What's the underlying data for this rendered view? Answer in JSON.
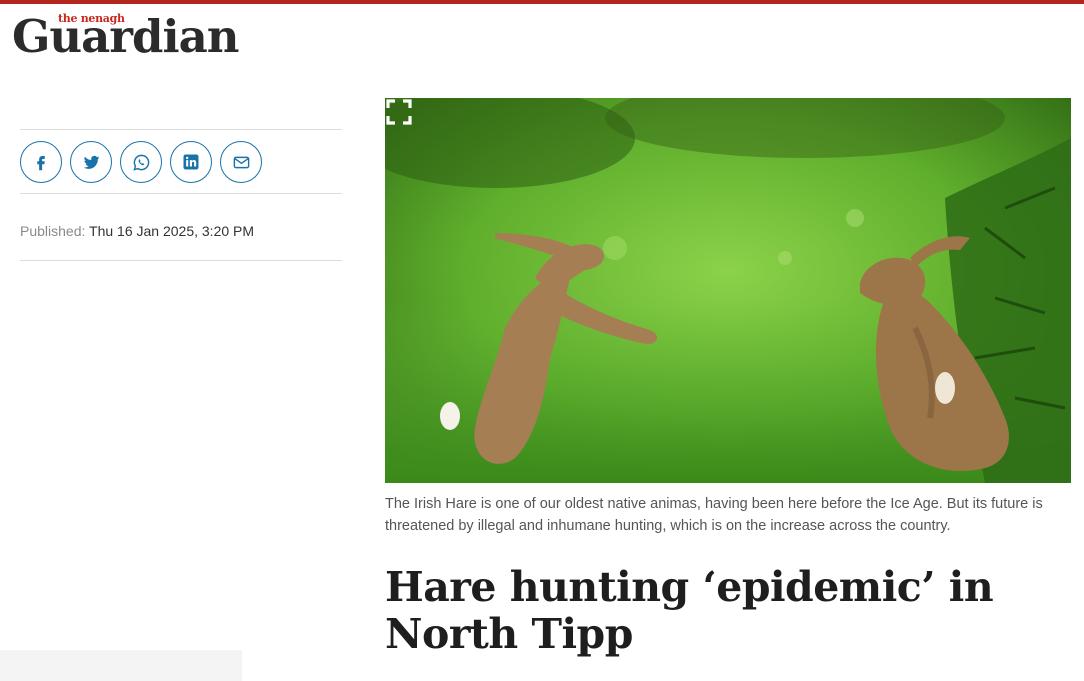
{
  "masthead": {
    "subtitle": "the nenagh",
    "title": "Guardian"
  },
  "share": {
    "buttons": [
      {
        "icon": "facebook-icon"
      },
      {
        "icon": "twitter-icon"
      },
      {
        "icon": "whatsapp-icon"
      },
      {
        "icon": "linkedin-icon"
      },
      {
        "icon": "email-icon"
      }
    ],
    "accent_color": "#1a73a8"
  },
  "published": {
    "label": "Published:",
    "value": "Thu 16 Jan 2025, 3:20 PM"
  },
  "article": {
    "image_caption": "The Irish Hare is one of our oldest native animas, having been here before the Ice Age. But its future is threatened by illegal and inhumane hunting, which is on the increase across the country.",
    "headline": "Hare hunting ‘epidemic’ in North Tipp",
    "expand_icon": "expand-icon"
  },
  "colors": {
    "brand_red": "#b3261e",
    "masthead_dark": "#2b2b2b"
  }
}
